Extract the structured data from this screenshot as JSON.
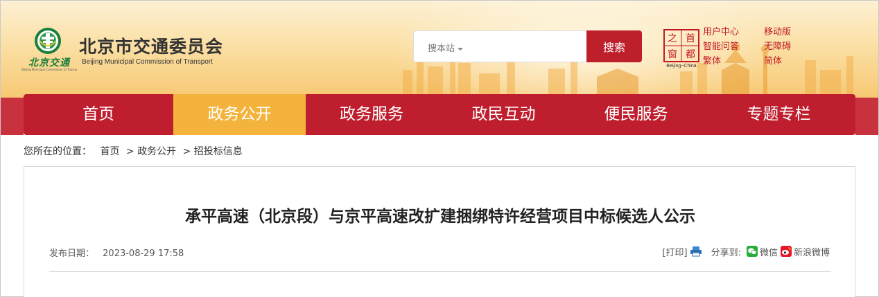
{
  "header": {
    "logo_word": "北京交通",
    "logo_small": "Beijing Municipal Commission of Transport",
    "site_title": "北京市交通委员会",
    "site_subtitle": "Beijing Municipal Commission of Transport",
    "search": {
      "scope_label": "搜本站",
      "button_label": "搜索"
    },
    "capital_logo": {
      "chars": [
        "之",
        "首",
        "窗",
        "都"
      ],
      "caption": "Beijing~China"
    },
    "utility_links": [
      "用户中心",
      "移动版",
      "智能问答",
      "无障碍",
      "繁体",
      "简体"
    ]
  },
  "nav": {
    "items": [
      {
        "label": "首页",
        "active": false
      },
      {
        "label": "政务公开",
        "active": true
      },
      {
        "label": "政务服务",
        "active": false
      },
      {
        "label": "政民互动",
        "active": false
      },
      {
        "label": "便民服务",
        "active": false
      },
      {
        "label": "专题专栏",
        "active": false
      }
    ]
  },
  "breadcrumb": {
    "prefix": "您所在的位置：",
    "items": [
      "首页",
      "政务公开",
      "招投标信息"
    ],
    "separator": ">"
  },
  "article": {
    "title": "承平高速（北京段）与京平高速改扩建捆绑特许经营项目中标候选人公示",
    "date_label": "发布日期：",
    "date_value": "2023-08-29 17:58",
    "print_label": "[打印]",
    "share_label": "分享到:",
    "share_wechat": "微信",
    "share_weibo": "新浪微博"
  },
  "colors": {
    "brand_red": "#be1e2d",
    "active_tab": "#f4b33c",
    "link_red": "#c21a27",
    "logo_green": "#1b7f3b"
  }
}
